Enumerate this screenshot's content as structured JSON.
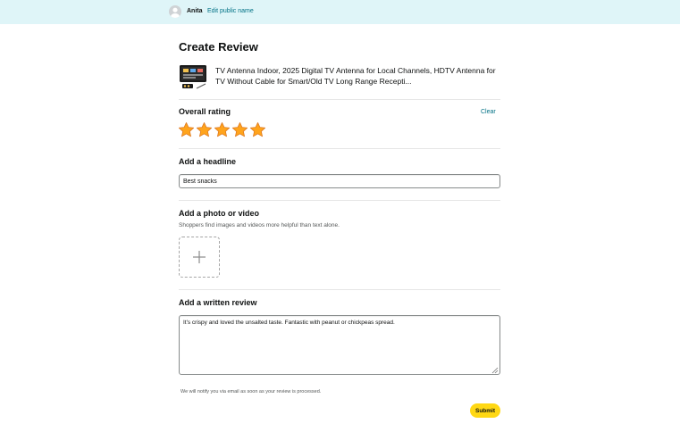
{
  "header": {
    "user_name": "Anita",
    "edit_link": "Edit public name",
    "avatar_icon": "user-avatar-icon"
  },
  "page": {
    "title": "Create Review"
  },
  "product": {
    "title": "TV Antenna Indoor, 2025 Digital TV Antenna for Local Channels, HDTV Antenna for TV Without Cable for Smart/Old TV Long Range Recepti..."
  },
  "rating": {
    "label": "Overall rating",
    "clear_label": "Clear",
    "value": 5,
    "max": 5,
    "star_color": "#ffa41c"
  },
  "headline": {
    "label": "Add a headline",
    "value": "Best snacks"
  },
  "media": {
    "label": "Add a photo or video",
    "helper": "Shoppers find images and videos more helpful than text alone.",
    "upload_icon": "plus-icon"
  },
  "review": {
    "label": "Add a written review",
    "value": "It's crispy and loved the unsalted taste. Fantastic with peanut or chickpeas spread."
  },
  "footer": {
    "notice": "We will notify you via email as soon as your review is processed.",
    "submit_label": "Submit",
    "submit_color": "#ffd814"
  }
}
